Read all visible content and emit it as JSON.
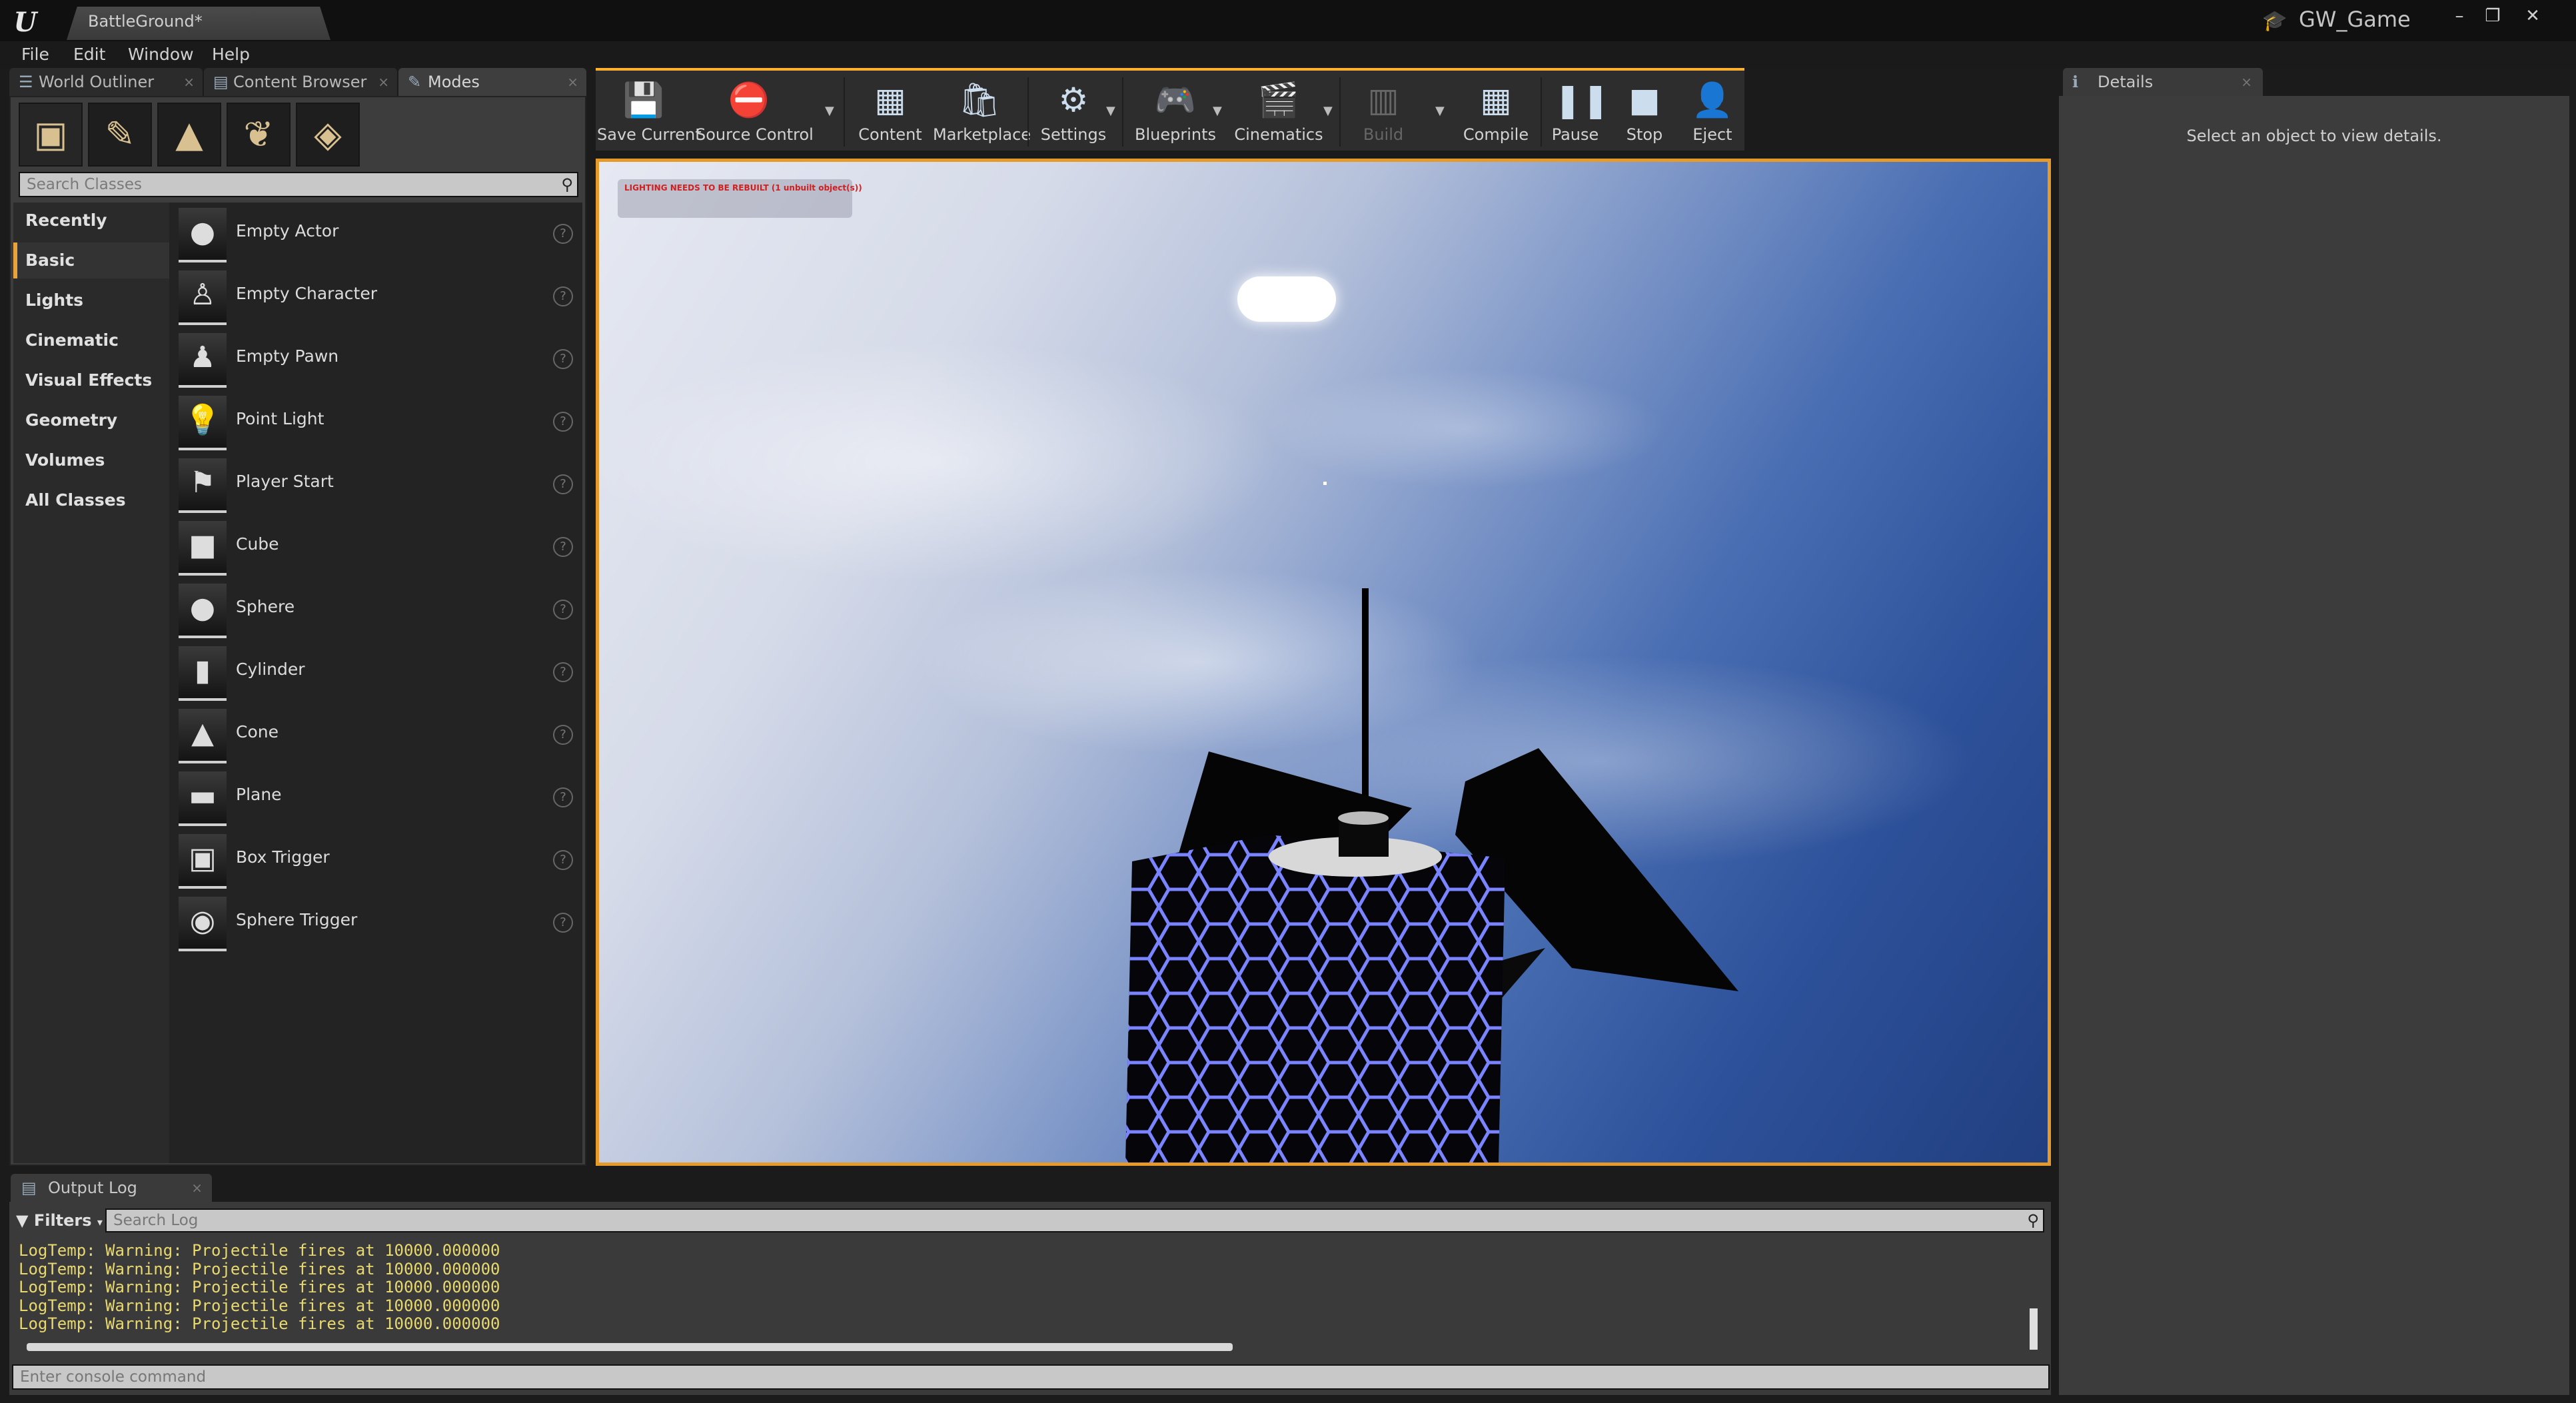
{
  "window": {
    "document_tab": "BattleGround*",
    "project_name": "GW_Game",
    "controls": {
      "minimize": "–",
      "maximize": "❐",
      "close": "✕"
    }
  },
  "menu": [
    "File",
    "Edit",
    "Window",
    "Help"
  ],
  "left_tabs": {
    "world_outliner": "World Outliner",
    "content_browser": "Content Browser",
    "modes": "Modes"
  },
  "modes": {
    "tool_icons": [
      "place-mode-icon",
      "paint-mode-icon",
      "landscape-mode-icon",
      "foliage-mode-icon",
      "geometry-mode-icon"
    ],
    "search_placeholder": "Search Classes",
    "categories": [
      "Recently Placed",
      "Basic",
      "Lights",
      "Cinematic",
      "Visual Effects",
      "Geometry",
      "Volumes",
      "All Classes"
    ],
    "selected_category": "Basic",
    "items": [
      {
        "label": "Empty Actor",
        "icon": "empty-actor-icon"
      },
      {
        "label": "Empty Character",
        "icon": "empty-character-icon"
      },
      {
        "label": "Empty Pawn",
        "icon": "empty-pawn-icon"
      },
      {
        "label": "Point Light",
        "icon": "point-light-icon"
      },
      {
        "label": "Player Start",
        "icon": "player-start-icon"
      },
      {
        "label": "Cube",
        "icon": "cube-icon"
      },
      {
        "label": "Sphere",
        "icon": "sphere-icon"
      },
      {
        "label": "Cylinder",
        "icon": "cylinder-icon"
      },
      {
        "label": "Cone",
        "icon": "cone-icon"
      },
      {
        "label": "Plane",
        "icon": "plane-icon"
      },
      {
        "label": "Box Trigger",
        "icon": "box-trigger-icon"
      },
      {
        "label": "Sphere Trigger",
        "icon": "sphere-trigger-icon"
      }
    ]
  },
  "toolbar": {
    "save_current": "Save Current",
    "source_control": "Source Control",
    "content": "Content",
    "marketplace": "Marketplace",
    "settings": "Settings",
    "blueprints": "Blueprints",
    "cinematics": "Cinematics",
    "build": "Build",
    "compile": "Compile",
    "pause": "Pause",
    "stop": "Stop",
    "eject": "Eject"
  },
  "viewport": {
    "lighting_warning": "LIGHTING NEEDS TO BE REBUILT (1 unbuilt object(s))"
  },
  "details": {
    "tab": "Details",
    "empty_message": "Select an object to view details."
  },
  "output_log": {
    "tab": "Output Log",
    "filters": "Filters",
    "search_placeholder": "Search Log",
    "lines": [
      "LogTemp: Warning: Projectile fires at 10000.000000",
      "LogTemp: Warning: Projectile fires at 10000.000000",
      "LogTemp: Warning: Projectile fires at 10000.000000",
      "LogTemp: Warning: Projectile fires at 10000.000000",
      "LogTemp: Warning: Projectile fires at 10000.000000"
    ],
    "console_placeholder": "Enter console command"
  },
  "colors": {
    "accent_orange": "#e69a2a",
    "log_warning": "#e8d870",
    "hex_glow": "#7a84ff"
  }
}
